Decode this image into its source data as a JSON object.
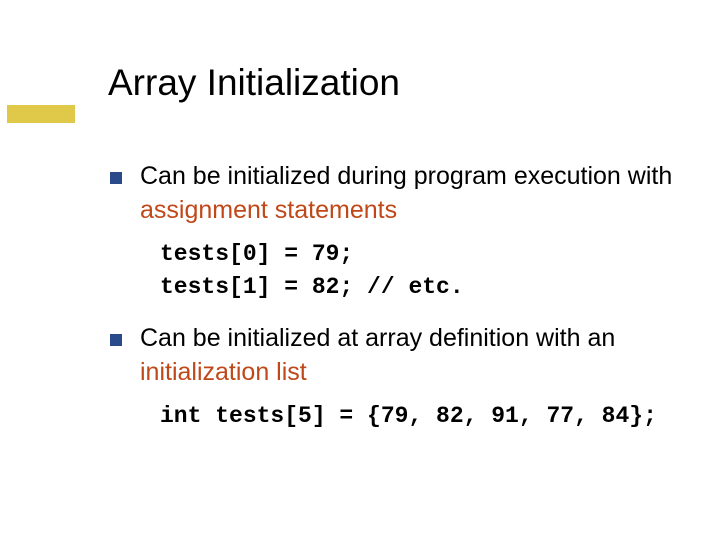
{
  "slide": {
    "title": "Array Initialization",
    "bullets": [
      {
        "text_parts": [
          "Can be initialized during program execution with ",
          "assignment statements"
        ],
        "code": "tests[0] = 79;\ntests[1] = 82; // etc."
      },
      {
        "text_parts": [
          "Can be initialized at array definition with an ",
          "initialization list"
        ],
        "code": "int tests[5] = {79, 82, 91, 77, 84};"
      }
    ]
  }
}
